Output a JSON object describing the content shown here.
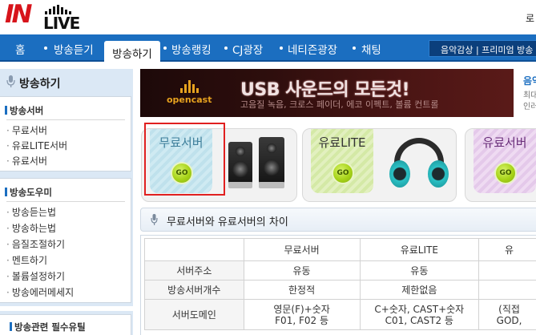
{
  "header": {
    "logo_text_in": "IN",
    "logo_text_live": "LIVE",
    "top_right_text": "로"
  },
  "nav": {
    "items": [
      "홈",
      "방송듣기",
      "방송하기",
      "방송랭킹",
      "CJ광장",
      "네티즌광장",
      "채팅"
    ],
    "active_index": 2,
    "right_label": "음악감상 | 프리미엄 방송"
  },
  "sidebar": {
    "title": "방송하기",
    "sections": [
      {
        "title": "방송서버",
        "links": [
          "무료서버",
          "유료LITE서버",
          "유료서버"
        ]
      },
      {
        "title": "방송도우미",
        "links": [
          "방송듣는법",
          "방송하는법",
          "음질조절하기",
          "멘트하기",
          "볼륨설정하기",
          "방송에러메세지"
        ]
      },
      {
        "title": "방송관련 필수유틸",
        "links": []
      }
    ]
  },
  "banner": {
    "brand": "opencast",
    "headline": "USB 사운드의 모든것!",
    "subline": "고음질 녹음, 크로스 페이더, 에코 이펙트, 볼륨 컨트롤",
    "side_line1": "음악",
    "side_line2": "최대",
    "side_line3": "인러"
  },
  "server_cards": [
    {
      "label": "무료서버",
      "go": "GO",
      "image": "speakers-icon"
    },
    {
      "label": "유료LITE",
      "go": "GO",
      "image": "headphones-icon"
    },
    {
      "label": "유료서버",
      "go": "GO",
      "image": ""
    }
  ],
  "comparison": {
    "title": "무료서버와 유료서버의 차이",
    "columns": [
      "",
      "무료서버",
      "유료LITE",
      "유"
    ],
    "rows": [
      {
        "label": "서버주소",
        "cells": [
          "유동",
          "유동",
          ""
        ]
      },
      {
        "label": "방송서버개수",
        "cells": [
          "한정적",
          "제한없음",
          ""
        ]
      },
      {
        "label": "서버도메인",
        "cells": [
          [
            "영문(F)+숫자",
            "F01, F02 등"
          ],
          [
            "C+숫자, CAST+숫자",
            "C01, CAST2 등"
          ],
          [
            "(직접",
            "GOD,"
          ]
        ]
      }
    ]
  },
  "colors": {
    "nav_blue": "#1b6ec0",
    "logo_red": "#d7141b",
    "highlight_red": "#e02020",
    "go_green": "#a7d318"
  }
}
